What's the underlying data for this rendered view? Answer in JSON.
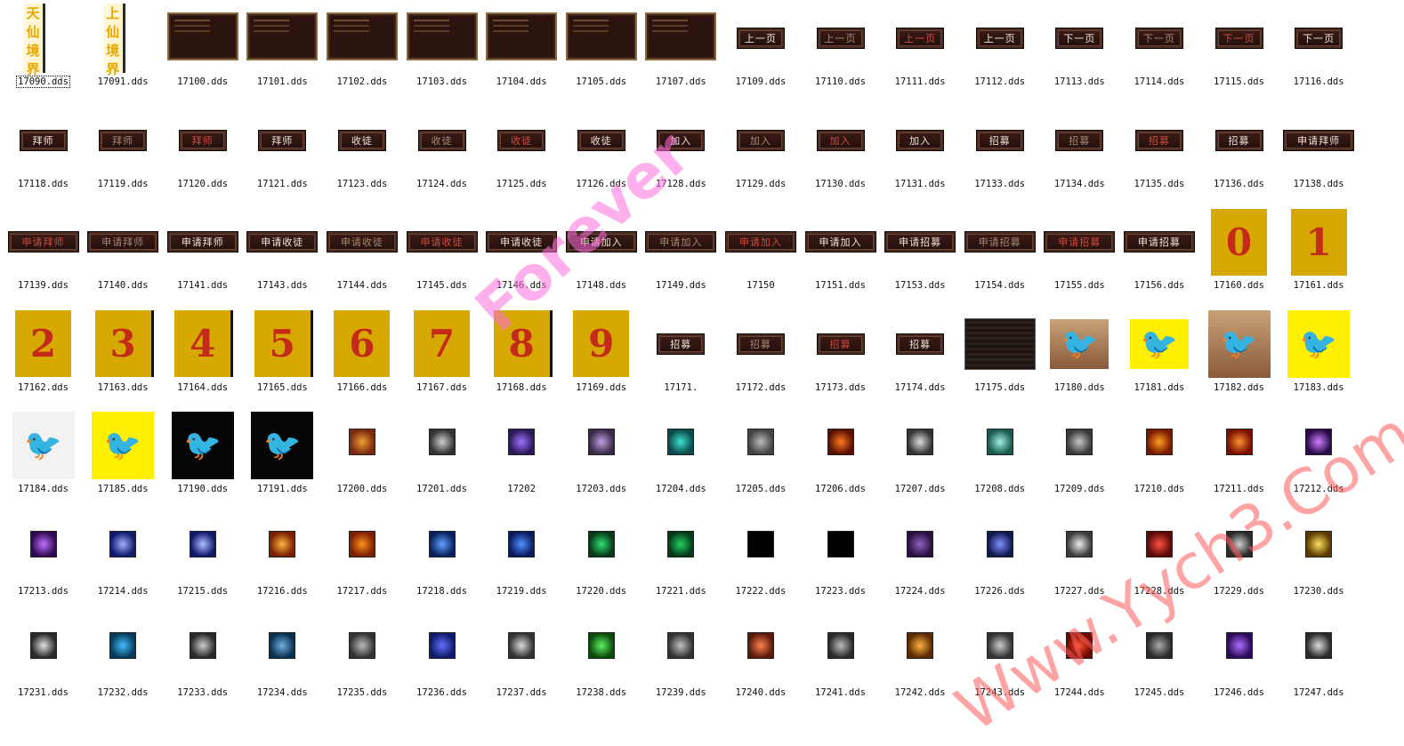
{
  "files": [
    {
      "name": "17090.dds",
      "kind": "vbanner",
      "chars": [
        "天",
        "仙",
        "境",
        "界"
      ],
      "selected": true
    },
    {
      "name": "17091.dds",
      "kind": "vbanner",
      "chars": [
        "上",
        "仙",
        "境",
        "界"
      ]
    },
    {
      "name": "17100.dds",
      "kind": "panel"
    },
    {
      "name": "17101.dds",
      "kind": "panel"
    },
    {
      "name": "17102.dds",
      "kind": "panel"
    },
    {
      "name": "17103.dds",
      "kind": "panel"
    },
    {
      "name": "17104.dds",
      "kind": "panel"
    },
    {
      "name": "17105.dds",
      "kind": "panel"
    },
    {
      "name": "17107.dds",
      "kind": "panel"
    },
    {
      "name": "17109.dds",
      "kind": "button",
      "text": "上一页",
      "style": "normal"
    },
    {
      "name": "17110.dds",
      "kind": "button",
      "text": "上一页",
      "style": "dim"
    },
    {
      "name": "17111.dds",
      "kind": "button",
      "text": "上一页",
      "style": "hl"
    },
    {
      "name": "17112.dds",
      "kind": "button",
      "text": "上一页",
      "style": "normal"
    },
    {
      "name": "17113.dds",
      "kind": "button",
      "text": "下一页",
      "style": "normal"
    },
    {
      "name": "17114.dds",
      "kind": "button",
      "text": "下一页",
      "style": "dim"
    },
    {
      "name": "17115.dds",
      "kind": "button",
      "text": "下一页",
      "style": "hl"
    },
    {
      "name": "17116.dds",
      "kind": "button",
      "text": "下一页",
      "style": "normal"
    },
    {
      "name": "17118.dds",
      "kind": "button",
      "text": "拜师",
      "style": "normal"
    },
    {
      "name": "17119.dds",
      "kind": "button",
      "text": "拜师",
      "style": "dim"
    },
    {
      "name": "17120.dds",
      "kind": "button",
      "text": "拜师",
      "style": "hl"
    },
    {
      "name": "17121.dds",
      "kind": "button",
      "text": "拜师",
      "style": "normal"
    },
    {
      "name": "17123.dds",
      "kind": "button",
      "text": "收徒",
      "style": "normal"
    },
    {
      "name": "17124.dds",
      "kind": "button",
      "text": "收徒",
      "style": "dim"
    },
    {
      "name": "17125.dds",
      "kind": "button",
      "text": "收徒",
      "style": "hl"
    },
    {
      "name": "17126.dds",
      "kind": "button",
      "text": "收徒",
      "style": "normal"
    },
    {
      "name": "17128.dds",
      "kind": "button",
      "text": "加入",
      "style": "normal"
    },
    {
      "name": "17129.dds",
      "kind": "button",
      "text": "加入",
      "style": "dim"
    },
    {
      "name": "17130.dds",
      "kind": "button",
      "text": "加入",
      "style": "hl"
    },
    {
      "name": "17131.dds",
      "kind": "button",
      "text": "加入",
      "style": "normal"
    },
    {
      "name": "17133.dds",
      "kind": "button",
      "text": "招募",
      "style": "normal"
    },
    {
      "name": "17134.dds",
      "kind": "button",
      "text": "招募",
      "style": "dim"
    },
    {
      "name": "17135.dds",
      "kind": "button",
      "text": "招募",
      "style": "hl"
    },
    {
      "name": "17136.dds",
      "kind": "button",
      "text": "招募",
      "style": "normal"
    },
    {
      "name": "17138.dds",
      "kind": "button",
      "text": "申请拜师",
      "style": "normal",
      "wide": true
    },
    {
      "name": "17139.dds",
      "kind": "button",
      "text": "申请拜师",
      "style": "hl",
      "wide": true
    },
    {
      "name": "17140.dds",
      "kind": "button",
      "text": "申请拜师",
      "style": "dim",
      "wide": true
    },
    {
      "name": "17141.dds",
      "kind": "button",
      "text": "申请拜师",
      "style": "normal",
      "wide": true
    },
    {
      "name": "17143.dds",
      "kind": "button",
      "text": "申请收徒",
      "style": "normal",
      "wide": true
    },
    {
      "name": "17144.dds",
      "kind": "button",
      "text": "申请收徒",
      "style": "dim",
      "wide": true
    },
    {
      "name": "17145.dds",
      "kind": "button",
      "text": "申请收徒",
      "style": "hl",
      "wide": true
    },
    {
      "name": "17146.dds",
      "kind": "button",
      "text": "申请收徒",
      "style": "normal",
      "wide": true
    },
    {
      "name": "17148.dds",
      "kind": "button",
      "text": "申请加入",
      "style": "normal",
      "wide": true
    },
    {
      "name": "17149.dds",
      "kind": "button",
      "text": "申请加入",
      "style": "dim",
      "wide": true
    },
    {
      "name": "17150",
      "kind": "button",
      "text": "申请加入",
      "style": "hl",
      "wide": true
    },
    {
      "name": "17151.dds",
      "kind": "button",
      "text": "申请加入",
      "style": "normal",
      "wide": true
    },
    {
      "name": "17153.dds",
      "kind": "button",
      "text": "申请招募",
      "style": "normal",
      "wide": true
    },
    {
      "name": "17154.dds",
      "kind": "button",
      "text": "申请招募",
      "style": "dim",
      "wide": true
    },
    {
      "name": "17155.dds",
      "kind": "button",
      "text": "申请招募",
      "style": "hl",
      "wide": true
    },
    {
      "name": "17156.dds",
      "kind": "button",
      "text": "申请招募",
      "style": "normal",
      "wide": true
    },
    {
      "name": "17160.dds",
      "kind": "digit",
      "text": "0"
    },
    {
      "name": "17161.dds",
      "kind": "digit",
      "text": "1"
    },
    {
      "name": "17162.dds",
      "kind": "digit",
      "text": "2"
    },
    {
      "name": "17163.dds",
      "kind": "digit",
      "text": "3",
      "shade": true
    },
    {
      "name": "17164.dds",
      "kind": "digit",
      "text": "4",
      "shade": true
    },
    {
      "name": "17165.dds",
      "kind": "digit",
      "text": "5",
      "shade": true
    },
    {
      "name": "17166.dds",
      "kind": "digit",
      "text": "6"
    },
    {
      "name": "17167.dds",
      "kind": "digit",
      "text": "7"
    },
    {
      "name": "17168.dds",
      "kind": "digit",
      "text": "8",
      "shade": true
    },
    {
      "name": "17169.dds",
      "kind": "digit",
      "text": "9"
    },
    {
      "name": "17171.",
      "kind": "button",
      "text": "招募",
      "style": "normal"
    },
    {
      "name": "17172.dds",
      "kind": "button",
      "text": "招募",
      "style": "dim"
    },
    {
      "name": "17173.dds",
      "kind": "button",
      "text": "招募",
      "style": "hl"
    },
    {
      "name": "17174.dds",
      "kind": "button",
      "text": "招募",
      "style": "normal"
    },
    {
      "name": "17175.dds",
      "kind": "darkbox"
    },
    {
      "name": "17180.dds",
      "kind": "bird",
      "bg": "tan"
    },
    {
      "name": "17181.dds",
      "kind": "bird",
      "bg": "yellow"
    },
    {
      "name": "17182.dds",
      "kind": "bird",
      "bg": "tan",
      "big": true
    },
    {
      "name": "17183.dds",
      "kind": "bird",
      "bg": "yellow",
      "big": true
    },
    {
      "name": "17184.dds",
      "kind": "bird",
      "bg": "white",
      "big": true
    },
    {
      "name": "17185.dds",
      "kind": "bird",
      "bg": "yellow",
      "big": true
    },
    {
      "name": "17190.dds",
      "kind": "bird",
      "bg": "black",
      "big": true
    },
    {
      "name": "17191.dds",
      "kind": "bird",
      "bg": "black",
      "big": true
    },
    {
      "name": "17200.dds",
      "kind": "icon",
      "colors": [
        "#7a2a10",
        "#f0a030"
      ]
    },
    {
      "name": "17201.dds",
      "kind": "icon",
      "colors": [
        "#333333",
        "#cfcfcf"
      ]
    },
    {
      "name": "17202",
      "kind": "icon",
      "colors": [
        "#2a1a5a",
        "#a070ff"
      ]
    },
    {
      "name": "17203.dds",
      "kind": "icon",
      "colors": [
        "#3a2a4a",
        "#c0a0e0"
      ]
    },
    {
      "name": "17204.dds",
      "kind": "icon",
      "colors": [
        "#0a4a4a",
        "#40e0d0"
      ]
    },
    {
      "name": "17205.dds",
      "kind": "icon",
      "colors": [
        "#444444",
        "#bbbbbb"
      ]
    },
    {
      "name": "17206.dds",
      "kind": "icon",
      "colors": [
        "#5a1000",
        "#ff7a20"
      ]
    },
    {
      "name": "17207.dds",
      "kind": "icon",
      "colors": [
        "#333333",
        "#dddddd"
      ]
    },
    {
      "name": "17208.dds",
      "kind": "icon",
      "colors": [
        "#1a5a50",
        "#a0f0e0"
      ]
    },
    {
      "name": "17209.dds",
      "kind": "icon",
      "colors": [
        "#3a3a3a",
        "#c8c8c8"
      ]
    },
    {
      "name": "17210.dds",
      "kind": "icon",
      "colors": [
        "#7a1800",
        "#ffa020"
      ]
    },
    {
      "name": "17211.dds",
      "kind": "icon",
      "colors": [
        "#7a1000",
        "#ff9030"
      ]
    },
    {
      "name": "17212.dds",
      "kind": "icon",
      "colors": [
        "#2a0a4a",
        "#d080ff"
      ]
    },
    {
      "name": "17213.dds",
      "kind": "icon",
      "colors": [
        "#300a50",
        "#c070ff"
      ]
    },
    {
      "name": "17214.dds",
      "kind": "icon",
      "colors": [
        "#101a6a",
        "#a0b0ff"
      ]
    },
    {
      "name": "17215.dds",
      "kind": "icon",
      "colors": [
        "#101a6a",
        "#b0c0ff"
      ]
    },
    {
      "name": "17216.dds",
      "kind": "icon",
      "colors": [
        "#7a2000",
        "#ffb040"
      ]
    },
    {
      "name": "17217.dds",
      "kind": "icon",
      "colors": [
        "#7a2000",
        "#ff9020"
      ]
    },
    {
      "name": "17218.dds",
      "kind": "icon",
      "colors": [
        "#0a2060",
        "#60a0ff"
      ]
    },
    {
      "name": "17219.dds",
      "kind": "icon",
      "colors": [
        "#0a1a60",
        "#5090ff"
      ]
    },
    {
      "name": "17220.dds",
      "kind": "icon",
      "colors": [
        "#063a1a",
        "#30e070"
      ]
    },
    {
      "name": "17221.dds",
      "kind": "icon",
      "colors": [
        "#063a1a",
        "#20d060"
      ]
    },
    {
      "name": "17222.dds",
      "kind": "icon",
      "colors": [
        "#000000",
        "#000000"
      ]
    },
    {
      "name": "17223.dds",
      "kind": "icon",
      "colors": [
        "#000000",
        "#000000"
      ]
    },
    {
      "name": "17224.dds",
      "kind": "icon",
      "colors": [
        "#2a1040",
        "#9060c0"
      ]
    },
    {
      "name": "17226.dds",
      "kind": "icon",
      "colors": [
        "#101a50",
        "#8090ff"
      ]
    },
    {
      "name": "17227.dds",
      "kind": "icon",
      "colors": [
        "#3a3a3a",
        "#eeeeee"
      ]
    },
    {
      "name": "17228.dds",
      "kind": "icon",
      "colors": [
        "#5a0a0a",
        "#ff5040"
      ]
    },
    {
      "name": "17229.dds",
      "kind": "icon",
      "colors": [
        "#2a2a2a",
        "#d0d0d0"
      ]
    },
    {
      "name": "17230.dds",
      "kind": "icon",
      "colors": [
        "#5a3a00",
        "#ffe060"
      ]
    },
    {
      "name": "17231.dds",
      "kind": "icon",
      "colors": [
        "#2a2a2a",
        "#e0e0e0"
      ]
    },
    {
      "name": "17232.dds",
      "kind": "icon",
      "colors": [
        "#0a3a5a",
        "#40c0ff"
      ]
    },
    {
      "name": "17233.dds",
      "kind": "icon",
      "colors": [
        "#2a2a2a",
        "#cccccc"
      ]
    },
    {
      "name": "17234.dds",
      "kind": "icon",
      "colors": [
        "#0a3050",
        "#70b0e0"
      ]
    },
    {
      "name": "17235.dds",
      "kind": "icon",
      "colors": [
        "#333333",
        "#bbbbbb"
      ]
    },
    {
      "name": "17236.dds",
      "kind": "icon",
      "colors": [
        "#101a6a",
        "#6070ff"
      ]
    },
    {
      "name": "17237.dds",
      "kind": "icon",
      "colors": [
        "#333333",
        "#d8d8d8"
      ]
    },
    {
      "name": "17238.dds",
      "kind": "icon",
      "colors": [
        "#0a4a0a",
        "#60f060"
      ]
    },
    {
      "name": "17239.dds",
      "kind": "icon",
      "colors": [
        "#333333",
        "#c0c0c0"
      ]
    },
    {
      "name": "17240.dds",
      "kind": "icon",
      "colors": [
        "#5a1a0a",
        "#ff8050"
      ]
    },
    {
      "name": "17241.dds",
      "kind": "icon",
      "colors": [
        "#2a2a2a",
        "#bbbbbb"
      ]
    },
    {
      "name": "17242.dds",
      "kind": "icon",
      "colors": [
        "#5a2a00",
        "#ffb040"
      ]
    },
    {
      "name": "17243.dds",
      "kind": "icon",
      "colors": [
        "#333333",
        "#cccccc"
      ]
    },
    {
      "name": "17244.dds",
      "kind": "icon",
      "colors": [
        "#6a0a00",
        "#ff5030"
      ]
    },
    {
      "name": "17245.dds",
      "kind": "icon",
      "colors": [
        "#2a2a2a",
        "#aaaaaa"
      ]
    },
    {
      "name": "17246.dds",
      "kind": "icon",
      "colors": [
        "#2a0a5a",
        "#b070ff"
      ]
    },
    {
      "name": "17247.dds",
      "kind": "icon",
      "colors": [
        "#2a2a2a",
        "#dddddd"
      ]
    }
  ],
  "watermark": {
    "brand": "Forever",
    "site": "Www.Yych3.Com"
  }
}
